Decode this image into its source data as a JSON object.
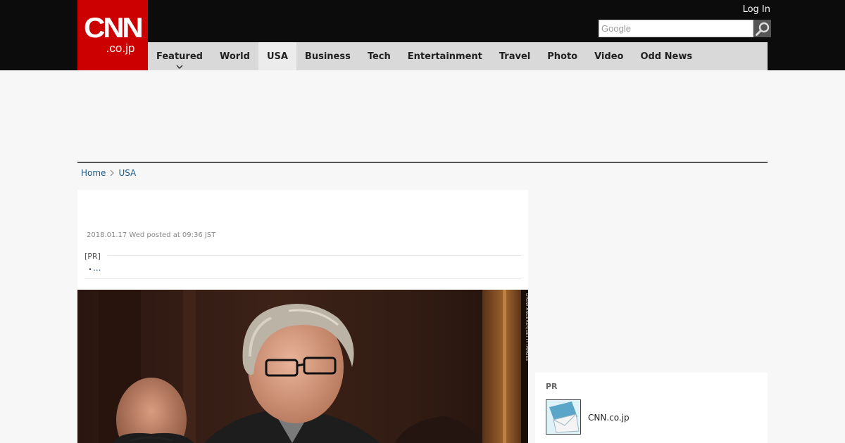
{
  "brand": {
    "logo_main": "CNN",
    "logo_sub": ".co.jp",
    "brand_color": "#cc0000"
  },
  "header": {
    "login_label": "Log In",
    "search": {
      "placeholder": "Google",
      "value": "",
      "icon": "search-icon"
    }
  },
  "nav": {
    "items": [
      {
        "label": "Featured",
        "has_dropdown": true
      },
      {
        "label": "World"
      },
      {
        "label": "USA",
        "active": true
      },
      {
        "label": "Business"
      },
      {
        "label": "Tech"
      },
      {
        "label": "Entertainment"
      },
      {
        "label": "Travel"
      },
      {
        "label": "Photo"
      },
      {
        "label": "Video"
      },
      {
        "label": "Odd News"
      }
    ]
  },
  "breadcrumb": {
    "home": "Home",
    "current": "USA",
    "separator_icon": "chevron-right-icon"
  },
  "article": {
    "posted": "2018.01.17 Wed posted at 09:36 JST",
    "pr_label": "[PR]",
    "pr_bullet": "・",
    "pr_link": "..."
  },
  "sidebar": {
    "pr_title": "PR",
    "pr_item_text": "CNN.co.jp"
  },
  "colors": {
    "header_bg": "#0c0c0c",
    "nav_bg": "#d9d9d9",
    "nav_active_bg": "#ececec",
    "link": "#1a5b8c",
    "page_bg": "#f7f7f7"
  }
}
